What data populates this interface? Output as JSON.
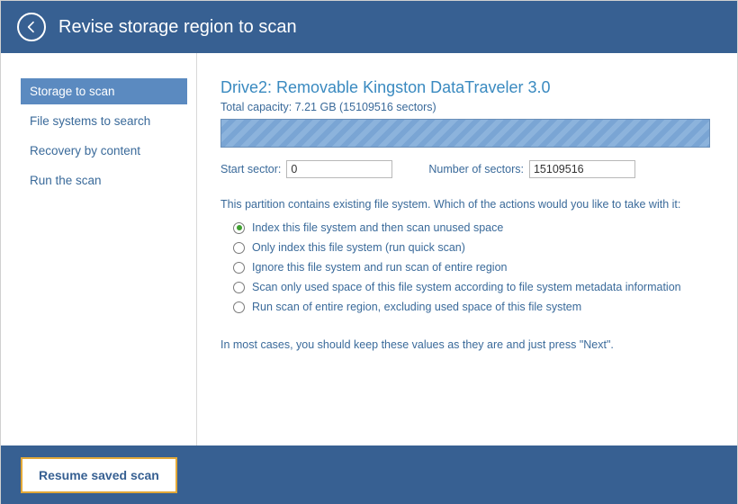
{
  "header": {
    "title": "Revise storage region to scan"
  },
  "sidebar": {
    "items": [
      {
        "label": "Storage to scan",
        "active": true
      },
      {
        "label": "File systems to search",
        "active": false
      },
      {
        "label": "Recovery by content",
        "active": false
      },
      {
        "label": "Run the scan",
        "active": false
      }
    ]
  },
  "main": {
    "drive_title": "Drive2: Removable Kingston DataTraveler 3.0",
    "capacity_text": "Total capacity: 7.21 GB (15109516 sectors)",
    "start_sector_label": "Start sector:",
    "start_sector_value": "0",
    "num_sectors_label": "Number of sectors:",
    "num_sectors_value": "15109516",
    "question": "This partition contains existing file system. Which of the actions would you like to take with it:",
    "options": [
      "Index this file system and then scan unused space",
      "Only index this file system (run quick scan)",
      "Ignore this file system and run scan of entire region",
      "Scan only used space of this file system according to file system metadata information",
      "Run scan of entire region, excluding used space of this file system"
    ],
    "selected_option": 0,
    "hint": "In most cases, you should keep these values as they are and just press \"Next\"."
  },
  "footer": {
    "resume_label": "Resume saved scan"
  }
}
